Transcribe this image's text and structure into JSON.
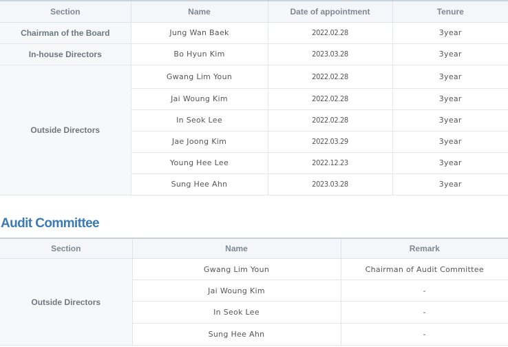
{
  "board": {
    "headers": [
      "Section",
      "Name",
      "Date of appointment",
      "Tenure"
    ],
    "groups": [
      {
        "section": "Chairman of the Board",
        "rows": [
          {
            "name": "Jung Wan Baek",
            "date": "2022.02.28",
            "tenure": "3year"
          }
        ]
      },
      {
        "section": "In-house Directors",
        "rows": [
          {
            "name": "Bo Hyun Kim",
            "date": "2023.03.28",
            "tenure": "3year"
          }
        ]
      },
      {
        "section": "Outside Directors",
        "rows": [
          {
            "name": "Gwang Lim Youn",
            "date": "2022.02.28",
            "tenure": "3year"
          },
          {
            "name": "Jai Woung Kim",
            "date": "2022.02.28",
            "tenure": "3year"
          },
          {
            "name": "In Seok Lee",
            "date": "2022.02.28",
            "tenure": "3year"
          },
          {
            "name": "Jae Joong Kim",
            "date": "2022.03.29",
            "tenure": "3year"
          },
          {
            "name": "Young Hee Lee",
            "date": "2022.12.23",
            "tenure": "3year"
          },
          {
            "name": "Sung Hee Ahn",
            "date": "2023.03.28",
            "tenure": "3year"
          }
        ]
      }
    ]
  },
  "audit": {
    "title": "Audit Committee",
    "headers": [
      "Section",
      "Name",
      "Remark"
    ],
    "section": "Outside Directors",
    "rows": [
      {
        "name": "Gwang Lim Youn",
        "remark": "Chairman of Audit Committee"
      },
      {
        "name": "Jai Woung Kim",
        "remark": "-"
      },
      {
        "name": "In Seok Lee",
        "remark": "-"
      },
      {
        "name": "Sung Hee Ahn",
        "remark": "-"
      }
    ]
  }
}
